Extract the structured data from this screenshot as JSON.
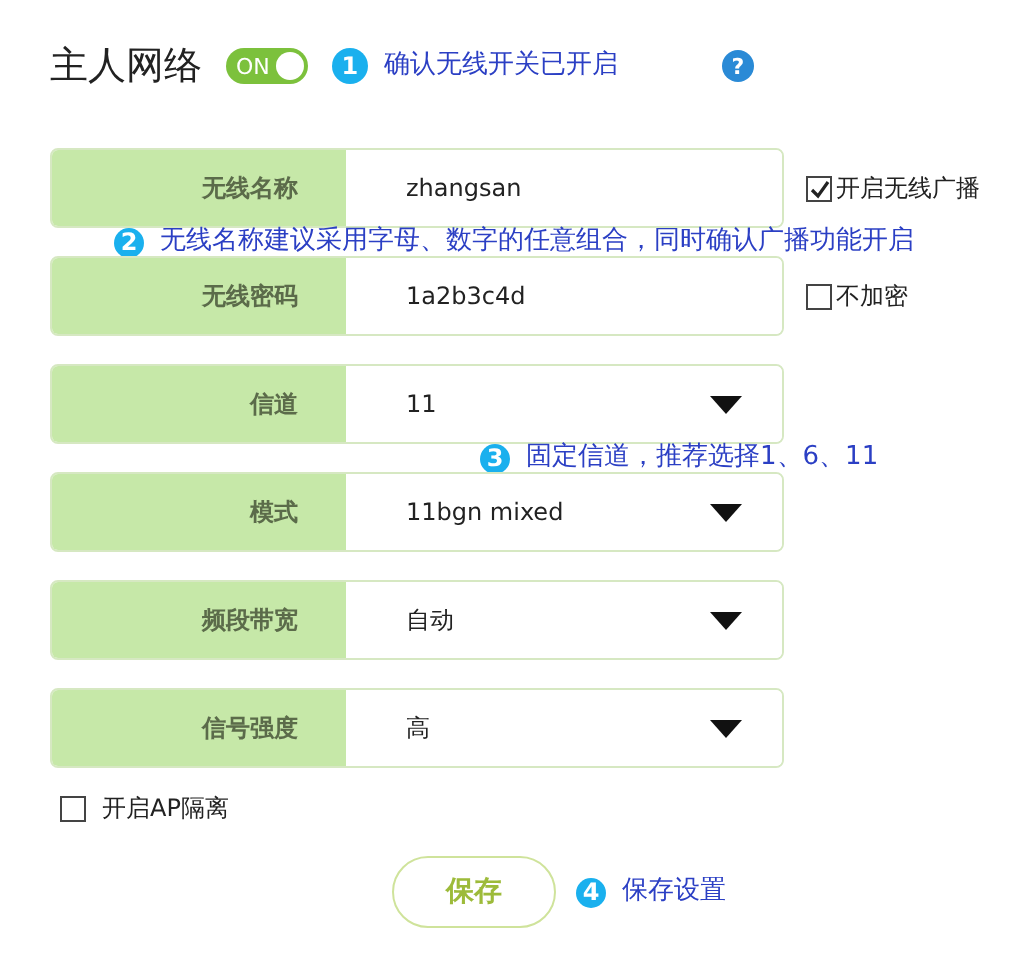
{
  "header": {
    "title": "主人网络",
    "toggle": {
      "label": "ON",
      "on": true
    },
    "note": {
      "number": "1",
      "text": "确认无线开关已开启"
    },
    "help": "?"
  },
  "rows": [
    {
      "kind": "text",
      "label": "无线名称",
      "value": "zhangsan",
      "option": {
        "label": "开启无线广播",
        "checked": true
      },
      "note": {
        "number": "2",
        "text": "无线名称建议采用字母、数字的任意组合，同时确认广播功能开启"
      }
    },
    {
      "kind": "text",
      "label": "无线密码",
      "value": "1a2b3c4d",
      "option": {
        "label": "不加密",
        "checked": false
      }
    },
    {
      "kind": "select",
      "label": "信道",
      "value": "11",
      "note": {
        "number": "3",
        "text": "固定信道，推荐选择1、6、11"
      }
    },
    {
      "kind": "select",
      "label": "模式",
      "value": "11bgn mixed"
    },
    {
      "kind": "select",
      "label": "频段带宽",
      "value": "自动"
    },
    {
      "kind": "select",
      "label": "信号强度",
      "value": "高"
    }
  ],
  "ap_isolation": {
    "label": "开启AP隔离",
    "checked": false
  },
  "save": {
    "label": "保存",
    "note": {
      "number": "4",
      "text": "保存设置"
    }
  }
}
